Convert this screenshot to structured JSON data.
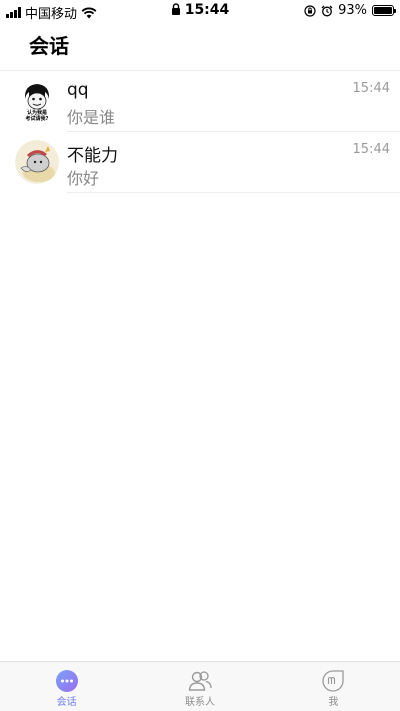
{
  "status_bar": {
    "carrier": "中国移动",
    "time": "15:44",
    "battery_percent": "93%"
  },
  "header": {
    "title": "会话"
  },
  "conversations": [
    {
      "name": "qq",
      "preview": "你是谁",
      "time": "15:44",
      "avatar_text": [
        "认为我是",
        "考试请我?"
      ]
    },
    {
      "name": "不能力",
      "preview": "你好",
      "time": "15:44"
    }
  ],
  "tabs": [
    {
      "label": "会话",
      "icon": "chat-bubble-icon",
      "active": true
    },
    {
      "label": "联系人",
      "icon": "contacts-icon",
      "active": false
    },
    {
      "label": "我",
      "icon": "profile-icon",
      "active": false
    }
  ],
  "colors": {
    "accent": "#6f7cf5",
    "inactive": "#8e8e8e"
  }
}
